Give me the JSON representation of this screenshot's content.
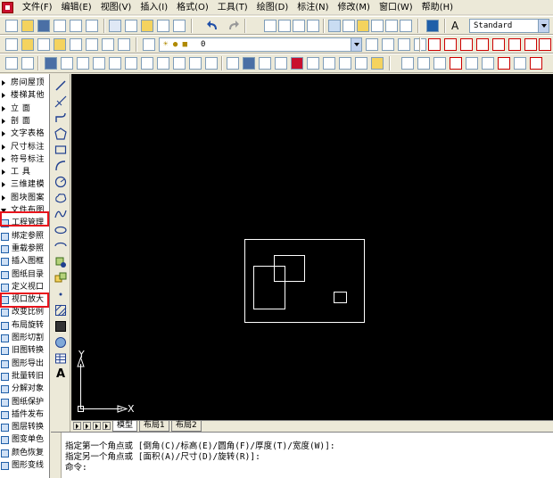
{
  "menu": [
    "文件(F)",
    "编辑(E)",
    "视图(V)",
    "插入(I)",
    "格式(O)",
    "工具(T)",
    "绘图(D)",
    "标注(N)",
    "修改(M)",
    "窗口(W)",
    "帮助(H)"
  ],
  "toolbar": {
    "text_style": "Standard",
    "layer_value": "0"
  },
  "palette": {
    "items": [
      {
        "label": "房间屋顶",
        "kind": "category"
      },
      {
        "label": "楼梯其他",
        "kind": "category"
      },
      {
        "label": "立    面",
        "kind": "category"
      },
      {
        "label": "剖    面",
        "kind": "category"
      },
      {
        "label": "文字表格",
        "kind": "category"
      },
      {
        "label": "尺寸标注",
        "kind": "category"
      },
      {
        "label": "符号标注",
        "kind": "category"
      },
      {
        "label": "工    具",
        "kind": "category"
      },
      {
        "label": "三维建模",
        "kind": "category"
      },
      {
        "label": "图块图案",
        "kind": "category"
      },
      {
        "label": "文件布图",
        "kind": "category-open"
      },
      {
        "label": "工程管理",
        "kind": "command"
      },
      {
        "label": "绑定参照",
        "kind": "command"
      },
      {
        "label": "重载参照",
        "kind": "command"
      },
      {
        "label": "插入图框",
        "kind": "command"
      },
      {
        "label": "图纸目录",
        "kind": "command"
      },
      {
        "label": "定义视口",
        "kind": "command"
      },
      {
        "label": "视口放大",
        "kind": "command"
      },
      {
        "label": "改变比例",
        "kind": "command"
      },
      {
        "label": "布局旋转",
        "kind": "command"
      },
      {
        "label": "图形切割",
        "kind": "command"
      },
      {
        "label": "旧图转换",
        "kind": "command"
      },
      {
        "label": "图形导出",
        "kind": "command"
      },
      {
        "label": "批量转旧",
        "kind": "command"
      },
      {
        "label": "分解对象",
        "kind": "command"
      },
      {
        "label": "图纸保护",
        "kind": "command"
      },
      {
        "label": "插件发布",
        "kind": "command"
      },
      {
        "label": "图层转换",
        "kind": "command"
      },
      {
        "label": "图变单色",
        "kind": "command"
      },
      {
        "label": "颜色恢复",
        "kind": "command"
      },
      {
        "label": "图形变线",
        "kind": "command"
      }
    ]
  },
  "canvas": {
    "ucs_x_label": "X",
    "ucs_y_label": "Y"
  },
  "tabs": [
    "模型",
    "布局1",
    "布局2"
  ],
  "command_lines": [
    "指定第一个角点或 [倒角(C)/标高(E)/圆角(F)/厚度(T)/宽度(W)]:",
    "指定另一个角点或 [面积(A)/尺寸(D)/旋转(R)]:",
    "命令:"
  ],
  "colors": {
    "highlight": "#e8141c",
    "canvas_bg": "#000000",
    "geometry": "#ffffff"
  }
}
